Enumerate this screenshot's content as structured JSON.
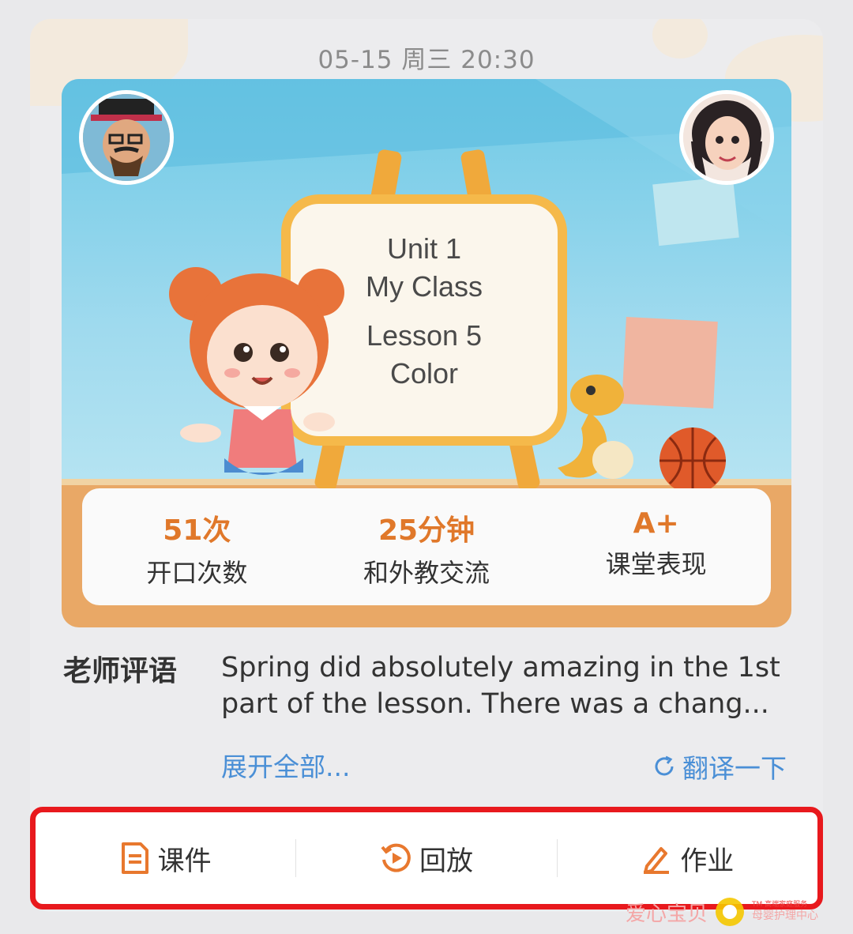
{
  "header": {
    "timestamp": "05-15 周三 20:30"
  },
  "banner": {
    "board_lines": [
      "Unit 1",
      "My Class",
      "Lesson 5",
      "Color"
    ],
    "teacher_avatar": "teacher-avatar",
    "student_avatar": "student-avatar"
  },
  "stats": [
    {
      "value": "51次",
      "label": "开口次数"
    },
    {
      "value": "25分钟",
      "label": "和外教交流"
    },
    {
      "value": "A+",
      "label": "课堂表现"
    }
  ],
  "comment": {
    "label": "老师评语",
    "text": "Spring did absolutely amazing in the 1st part of the lesson. There was a chang...",
    "expand": "展开全部...",
    "translate": "翻译一下"
  },
  "actions": [
    {
      "label": "课件",
      "icon": "document-icon"
    },
    {
      "label": "回放",
      "icon": "replay-icon"
    },
    {
      "label": "作业",
      "icon": "pencil-icon"
    }
  ],
  "watermark": {
    "brand": "爱心宝贝",
    "tagline": "TM 高端家庭服务",
    "sub": "母婴护理中心"
  },
  "colors": {
    "accent": "#e0782a",
    "link": "#4a8fd6",
    "highlight_border": "#e8191d"
  }
}
